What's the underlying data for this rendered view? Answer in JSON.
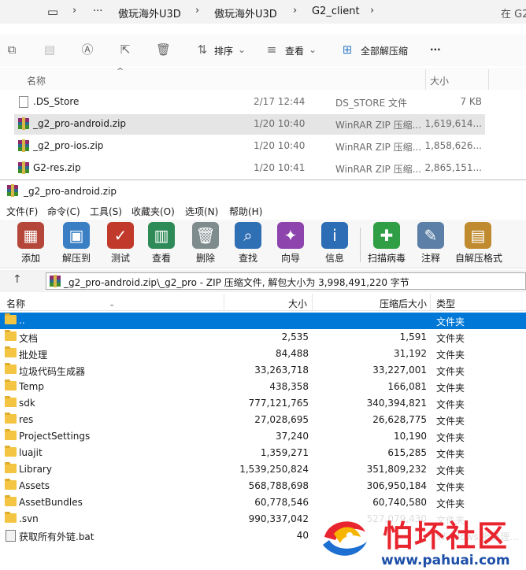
{
  "explorer": {
    "breadcrumb": [
      "傲玩海外U3D",
      "傲玩海外U3D",
      "G2_client"
    ],
    "breadcrumb_more": "···",
    "search_hint": "在 G2",
    "toolbar": {
      "sort_label": "排序",
      "view_label": "查看",
      "extract_all_label": "全部解压缩",
      "more_label": "···"
    },
    "columns": {
      "name": "名称",
      "size": "大小"
    },
    "rows": [
      {
        "name": ".DS_Store",
        "date": "2/17 12:44",
        "type": "DS_STORE 文件",
        "size": "7 KB"
      },
      {
        "name": "_g2_pro-android.zip",
        "date": "1/20 10:40",
        "type": "WinRAR ZIP 压缩...",
        "size": "1,619,614..."
      },
      {
        "name": "_g2_pro-ios.zip",
        "date": "1/20 10:40",
        "type": "WinRAR ZIP 压缩...",
        "size": "1,858,626..."
      },
      {
        "name": "G2-res.zip",
        "date": "1/20 10:41",
        "type": "WinRAR ZIP 压缩...",
        "size": "2,865,151..."
      }
    ]
  },
  "winrar": {
    "title": "_g2_pro-android.zip",
    "menu": [
      "文件(F)",
      "命令(C)",
      "工具(S)",
      "收藏夹(O)",
      "选项(N)",
      "帮助(H)"
    ],
    "tools": [
      {
        "label": "添加",
        "icon": "add-icon",
        "color": "#b5473a"
      },
      {
        "label": "解压到",
        "icon": "extract-to-icon",
        "color": "#3a7fc4"
      },
      {
        "label": "测试",
        "icon": "test-icon",
        "color": "#c0392b"
      },
      {
        "label": "查看",
        "icon": "view-icon",
        "color": "#2e8b57"
      },
      {
        "label": "删除",
        "icon": "delete-icon",
        "color": "#7f8c8d"
      },
      {
        "label": "查找",
        "icon": "find-icon",
        "color": "#2f6fb3"
      },
      {
        "label": "向导",
        "icon": "wizard-icon",
        "color": "#8e44ad"
      },
      {
        "label": "信息",
        "icon": "info-icon",
        "color": "#2c6db5"
      },
      {
        "label": "扫描病毒",
        "icon": "scan-virus-icon",
        "color": "#2f9e44"
      },
      {
        "label": "注释",
        "icon": "comment-icon",
        "color": "#5b7fa6"
      },
      {
        "label": "自解压格式",
        "icon": "sfx-icon",
        "color": "#c08a2e"
      }
    ],
    "address": "_g2_pro-android.zip\\_g2_pro - ZIP 压缩文件, 解包大小为 3,998,491,220 字节",
    "columns": {
      "name": "名称",
      "size": "大小",
      "packed": "压缩后大小",
      "type": "类型"
    },
    "files": [
      {
        "name": "..",
        "size": "",
        "packed": "",
        "type": "文件夹",
        "kind": "folder",
        "selected": true
      },
      {
        "name": "文档",
        "size": "2,535",
        "packed": "1,591",
        "type": "文件夹",
        "kind": "folder"
      },
      {
        "name": "批处理",
        "size": "84,488",
        "packed": "31,192",
        "type": "文件夹",
        "kind": "folder"
      },
      {
        "name": "垃圾代码生成器",
        "size": "33,263,718",
        "packed": "33,227,001",
        "type": "文件夹",
        "kind": "folder"
      },
      {
        "name": "Temp",
        "size": "438,358",
        "packed": "166,081",
        "type": "文件夹",
        "kind": "folder"
      },
      {
        "name": "sdk",
        "size": "777,121,765",
        "packed": "340,394,821",
        "type": "文件夹",
        "kind": "folder"
      },
      {
        "name": "res",
        "size": "27,028,695",
        "packed": "26,628,775",
        "type": "文件夹",
        "kind": "folder"
      },
      {
        "name": "ProjectSettings",
        "size": "37,240",
        "packed": "10,190",
        "type": "文件夹",
        "kind": "folder"
      },
      {
        "name": "luajit",
        "size": "1,359,271",
        "packed": "615,285",
        "type": "文件夹",
        "kind": "folder"
      },
      {
        "name": "Library",
        "size": "1,539,250,824",
        "packed": "351,809,232",
        "type": "文件夹",
        "kind": "folder"
      },
      {
        "name": "Assets",
        "size": "568,788,698",
        "packed": "306,950,184",
        "type": "文件夹",
        "kind": "folder"
      },
      {
        "name": "AssetBundles",
        "size": "60,778,546",
        "packed": "60,740,580",
        "type": "文件夹",
        "kind": "folder"
      },
      {
        "name": ".svn",
        "size": "990,337,042",
        "packed": "527,079,430",
        "type": "文件夹",
        "kind": "folder"
      },
      {
        "name": "获取所有外链.bat",
        "size": "40",
        "packed": "",
        "type": "Windows 批处理...",
        "kind": "bat"
      }
    ]
  },
  "watermark": {
    "title": "怕坏社区",
    "url": "www.pahuai.com"
  }
}
